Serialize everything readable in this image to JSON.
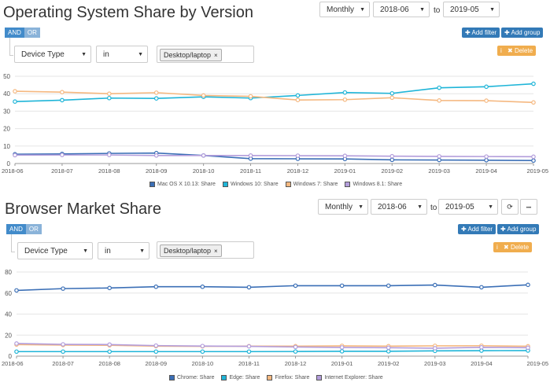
{
  "sections": [
    {
      "title": "Operating System Share by Version",
      "period": "Monthly",
      "from": "2018-06",
      "to_label": "to",
      "to": "2019-05",
      "and": "AND",
      "or": "OR",
      "add_filter": "Add filter",
      "add_group": "Add group",
      "delete": "Delete",
      "field": "Device Type",
      "operator": "in",
      "value_tag": "Desktop/laptop",
      "tag_remove": "×"
    },
    {
      "title": "Browser Market Share",
      "period": "Monthly",
      "from": "2018-06",
      "to_label": "to",
      "to": "2019-05",
      "and": "AND",
      "or": "OR",
      "add_filter": "Add filter",
      "add_group": "Add group",
      "delete": "Delete",
      "field": "Device Type",
      "operator": "in",
      "value_tag": "Desktop/laptop",
      "tag_remove": "×"
    }
  ],
  "icons": {
    "plus": "✚",
    "x": "✖",
    "info": "i",
    "refresh": "⟳",
    "more": "•••",
    "caret": "▼"
  },
  "chart_data": [
    {
      "type": "line",
      "x": [
        "2018-06",
        "2018-07",
        "2018-08",
        "2018-09",
        "2018-10",
        "2018-11",
        "2018-12",
        "2019-01",
        "2019-02",
        "2019-03",
        "2019-04",
        "2019-05"
      ],
      "ylim": [
        0,
        50
      ],
      "yticks": [
        0,
        10,
        20,
        30,
        40,
        50
      ],
      "grid": true,
      "legend_position": "bottom-center",
      "series": [
        {
          "name": "Mac OS X 10.13: Share",
          "color": "#3b6fb6",
          "values": [
            5.3,
            5.5,
            5.8,
            6.0,
            4.6,
            2.8,
            2.7,
            2.6,
            2.1,
            2.0,
            1.9,
            1.7
          ]
        },
        {
          "name": "Windows 10: Share",
          "color": "#1fb5d8",
          "values": [
            35.5,
            36.3,
            37.5,
            37.3,
            38.2,
            37.5,
            39.0,
            40.7,
            40.2,
            43.4,
            44.0,
            45.7
          ]
        },
        {
          "name": "Windows 7: Share",
          "color": "#f5b880",
          "values": [
            41.4,
            40.9,
            40.0,
            40.6,
            39.0,
            38.5,
            36.4,
            36.6,
            37.7,
            36.1,
            36.0,
            35.0
          ]
        },
        {
          "name": "Windows 8.1: Share",
          "color": "#b39ddb",
          "values": [
            4.8,
            4.9,
            4.9,
            4.6,
            4.6,
            4.6,
            4.5,
            4.4,
            4.2,
            4.1,
            4.0,
            3.9
          ]
        }
      ]
    },
    {
      "type": "line",
      "x": [
        "2018-06",
        "2018-07",
        "2018-08",
        "2018-09",
        "2018-10",
        "2018-11",
        "2018-12",
        "2019-01",
        "2019-02",
        "2019-03",
        "2019-04",
        "2019-05"
      ],
      "ylim": [
        0,
        80
      ],
      "yticks": [
        0,
        20,
        40,
        60,
        80
      ],
      "grid": true,
      "legend_position": "bottom-center",
      "series": [
        {
          "name": "Chrome: Share",
          "color": "#3b6fb6",
          "values": [
            62.5,
            64.2,
            64.8,
            66.0,
            66.0,
            65.5,
            67.0,
            67.0,
            67.0,
            67.6,
            65.5,
            67.8
          ]
        },
        {
          "name": "Edge: Share",
          "color": "#1fb5d8",
          "values": [
            4.3,
            4.3,
            4.3,
            4.3,
            4.3,
            4.3,
            4.4,
            4.6,
            4.6,
            5.0,
            5.2,
            5.3
          ]
        },
        {
          "name": "Firefox: Share",
          "color": "#f5b880",
          "values": [
            11.0,
            10.5,
            10.3,
            9.5,
            9.3,
            9.5,
            9.5,
            9.8,
            9.5,
            9.8,
            9.9,
            9.4
          ]
        },
        {
          "name": "Internet Explorer: Share",
          "color": "#b39ddb",
          "values": [
            12.0,
            11.2,
            11.0,
            10.0,
            9.6,
            9.3,
            8.7,
            8.3,
            8.0,
            7.5,
            8.4,
            8.0
          ]
        }
      ]
    }
  ]
}
